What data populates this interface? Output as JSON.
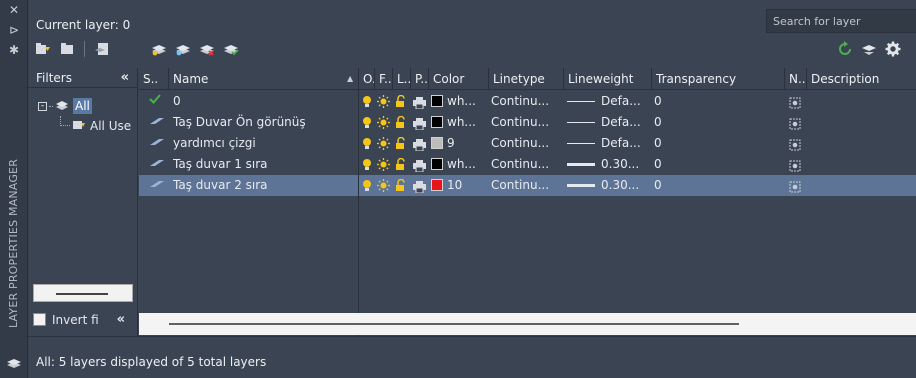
{
  "panel_title": "LAYER PROPERTIES MANAGER",
  "current_layer_label": "Current layer: 0",
  "search": {
    "placeholder": "Search for layer"
  },
  "toolbar": {
    "left_icons": [
      "new-property-filter-icon",
      "new-group-filter-icon",
      "layer-states-manager-icon"
    ],
    "layer_icons": [
      "new-layer-icon",
      "new-layer-vp-frozen-icon",
      "delete-layer-icon",
      "set-current-icon"
    ],
    "right_icons": [
      "refresh-icon",
      "settings-icon"
    ]
  },
  "filters": {
    "header": "Filters",
    "collapse_glyph": "«",
    "tree": [
      {
        "label": "All",
        "selected": true
      },
      {
        "label": "All Use"
      }
    ],
    "invert_label": "Invert fi",
    "invert_checked": false
  },
  "grid": {
    "columns": {
      "status": "S..",
      "name": "Name",
      "on": "O..",
      "freeze": "F..",
      "lock": "L..",
      "plot": "P..",
      "color": "Color",
      "linetype": "Linetype",
      "lineweight": "Lineweight",
      "transparency": "Transparency",
      "new_vp_freeze": "N..",
      "description": "Description"
    },
    "rows": [
      {
        "current": true,
        "name": "0",
        "color_hex": "#000000",
        "color_name": "wh...",
        "linetype": "Continu...",
        "lineweight": "Defa...",
        "lw_thick": false,
        "transparency": "0",
        "selected": false
      },
      {
        "current": false,
        "name": "Taş Duvar Ön görünüş",
        "color_hex": "#000000",
        "color_name": "wh...",
        "linetype": "Continu...",
        "lineweight": "Defa...",
        "lw_thick": false,
        "transparency": "0",
        "selected": false
      },
      {
        "current": false,
        "name": "yardımcı çizgi",
        "color_hex": "#bdbdbd",
        "color_name": "9",
        "linetype": "Continu...",
        "lineweight": "Defa...",
        "lw_thick": false,
        "transparency": "0",
        "selected": false
      },
      {
        "current": false,
        "name": "Taş duvar 1 sıra",
        "color_hex": "#000000",
        "color_name": "wh...",
        "linetype": "Continu...",
        "lineweight": "0.30...",
        "lw_thick": true,
        "transparency": "0",
        "selected": false
      },
      {
        "current": false,
        "name": "Taş duvar 2 sıra",
        "color_hex": "#e8161b",
        "color_name": "10",
        "linetype": "Continu...",
        "lineweight": "0.30...",
        "lw_thick": true,
        "transparency": "0",
        "selected": true
      }
    ]
  },
  "status_text": "All: 5 layers displayed of 5 total layers",
  "colors": {
    "background": "#3b4453",
    "selection": "#5d7496",
    "accent_green": "#4caf50",
    "bulb_yellow": "#f5c518"
  }
}
